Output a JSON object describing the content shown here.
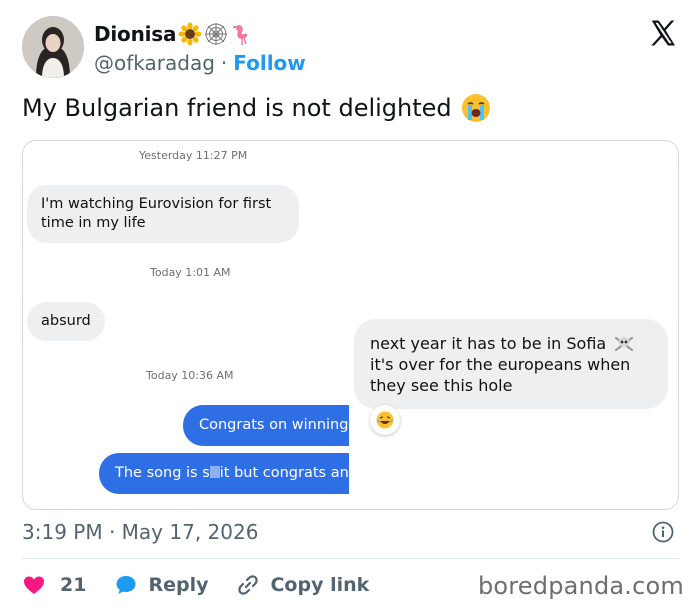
{
  "tweet": {
    "display_name": "Dionisa",
    "name_emojis": [
      "sunflower-icon",
      "spider-web-icon",
      "flamingo-icon"
    ],
    "handle": "@ofkaradag",
    "separator": "·",
    "follow_label": "Follow",
    "text": "My Bulgarian friend is not delighted",
    "timestamp": "3:19 PM · May 17, 2026",
    "like_count": "21",
    "reply_label": "Reply",
    "copy_link_label": "Copy link"
  },
  "chat": {
    "ts1": "Yesterday 11:27 PM",
    "msg1": "I'm watching Eurovision for first time in my life",
    "ts2": "Today 1:01 AM",
    "msg2": "absurd",
    "ts3": "Today 10:36 AM",
    "msg3": "Congrats on winning b",
    "msg4_a": "The song is s",
    "msg4_b": "it but congrats anywa",
    "msg5_a": "next year it has to be in Sofia",
    "msg5_b": "it's over for the europeans when they see this hole",
    "reaction": "laughing-emoji"
  },
  "watermark": "boredpanda.com",
  "colors": {
    "link_blue": "#1d9bf0",
    "outgoing_bubble": "#2f6fe6",
    "incoming_bubble": "#eeeff1",
    "like_heart": "#f91880",
    "muted_text": "#536471"
  }
}
